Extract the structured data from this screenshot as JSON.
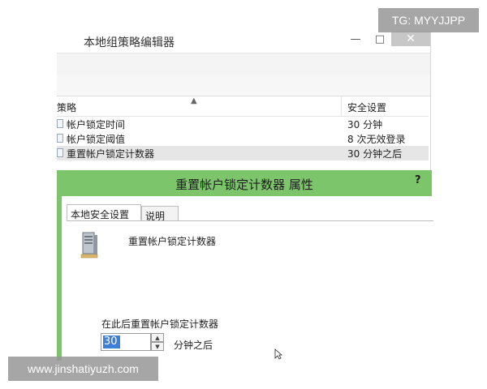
{
  "gpe": {
    "title": "本地组策略编辑器",
    "window_controls": {
      "minimize": "—",
      "maximize": "□",
      "close": "✕"
    },
    "list": {
      "header_policy": "策略",
      "header_setting": "安全设置",
      "sort_icon": "▲",
      "rows": [
        {
          "name": "帐户锁定时间",
          "value": "30 分钟",
          "selected": false
        },
        {
          "name": "帐户锁定阈值",
          "value": "8 次无效登录",
          "selected": false
        },
        {
          "name": "重置帐户锁定计数器",
          "value": "30 分钟之后",
          "selected": true
        }
      ]
    }
  },
  "dialog": {
    "title": "重置帐户锁定计数器 属性",
    "help": "?",
    "tabs": [
      {
        "label": "本地安全设置",
        "active": true
      },
      {
        "label": "说明",
        "active": false
      }
    ],
    "icon": "server-icon",
    "policy_name": "重置帐户锁定计数器",
    "reset_label": "在此后重置帐户锁定计数器",
    "spin": {
      "value": "30",
      "up": "▲",
      "down": "▼"
    },
    "unit_label": "分钟之后",
    "accent_color": "#7cc56b"
  },
  "overlays": {
    "tg": "TG: MYYJJPP",
    "url": "www.jinshatiyuzh.com"
  }
}
